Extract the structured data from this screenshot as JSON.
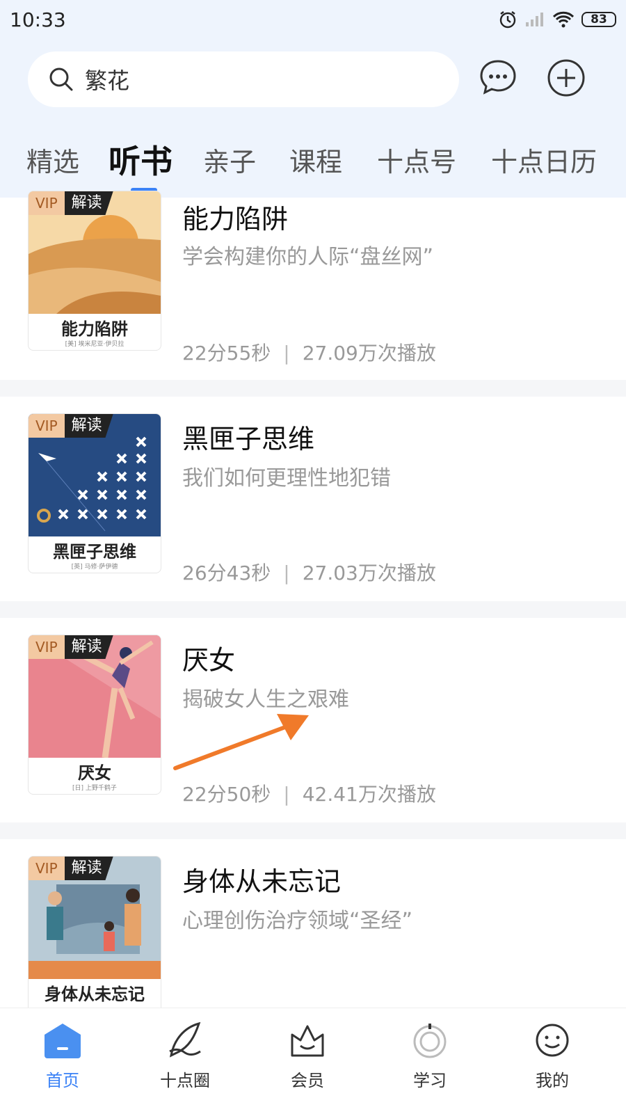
{
  "status_bar": {
    "time": "10:33",
    "battery": "83"
  },
  "search": {
    "query": "繁花"
  },
  "tabs": [
    {
      "label": "精选"
    },
    {
      "label": "听书"
    },
    {
      "label": "亲子"
    },
    {
      "label": "课程"
    },
    {
      "label": "十点号"
    },
    {
      "label": "十点日历"
    }
  ],
  "active_tab": "听书",
  "badge": {
    "vip": "VIP",
    "type": "解读"
  },
  "items": [
    {
      "title": "能力陷阱",
      "subtitle": "学会构建你的人际“盘丝网”",
      "duration": "22分55秒",
      "plays": "27.09万次播放",
      "cover_title": "能力陷阱",
      "cover_author": "[美] 埃米尼亚·伊贝拉"
    },
    {
      "title": "黑匣子思维",
      "subtitle": "我们如何更理性地犯错",
      "duration": "26分43秒",
      "plays": "27.03万次播放",
      "cover_title": "黑匣子思维",
      "cover_author": "[英] 马修·萨伊德"
    },
    {
      "title": "厌女",
      "subtitle": "揭破女人生之艰难",
      "duration": "22分50秒",
      "plays": "42.41万次播放",
      "cover_title": "厌女",
      "cover_author": "[日] 上野千鹤子"
    },
    {
      "title": "身体从未忘记",
      "subtitle": "心理创伤治疗领域“圣经”",
      "duration": "",
      "plays": "",
      "cover_title": "身体从未忘记",
      "cover_author": ""
    }
  ],
  "bottom_nav": [
    {
      "label": "首页",
      "icon": "home-icon"
    },
    {
      "label": "十点圈",
      "icon": "feather-icon"
    },
    {
      "label": "会员",
      "icon": "crown-icon"
    },
    {
      "label": "学习",
      "icon": "study-circle-icon"
    },
    {
      "label": "我的",
      "icon": "smile-icon"
    }
  ],
  "colors": {
    "accent": "#3b82f6",
    "header_bg": "#eef4fd",
    "arrow": "#f07a2a"
  }
}
